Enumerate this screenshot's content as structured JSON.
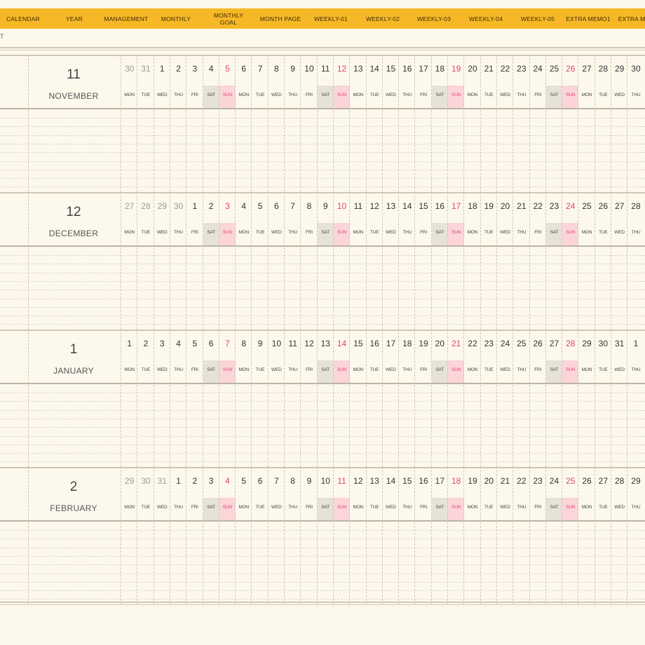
{
  "tabs": [
    {
      "label": "CALENDAR"
    },
    {
      "label": "YEAR"
    },
    {
      "label": "MANAGEMENT"
    },
    {
      "label": "MONTHLY"
    },
    {
      "label": "MONTHLY\nGOAL"
    },
    {
      "label": "MONTH PAGE"
    },
    {
      "label": "WEEKLY-01"
    },
    {
      "label": "WEEKLY-02"
    },
    {
      "label": "WEEKLY-03"
    },
    {
      "label": "WEEKLY-04"
    },
    {
      "label": "WEEKLY-05"
    },
    {
      "label": "EXTRA MEMO1"
    },
    {
      "label": "EXTRA ME"
    }
  ],
  "top_text": "T",
  "weekday_labels": [
    "MON",
    "TUE",
    "WED",
    "THU",
    "FRI",
    "SAT",
    "SUN"
  ],
  "months": [
    {
      "number": "11",
      "name": "NOVEMBER",
      "days": [
        "30",
        "31",
        "1",
        "2",
        "3",
        "4",
        "5",
        "6",
        "7",
        "8",
        "9",
        "10",
        "11",
        "12",
        "13",
        "14",
        "15",
        "16",
        "17",
        "18",
        "19",
        "20",
        "21",
        "22",
        "23",
        "24",
        "25",
        "26",
        "27",
        "28",
        "29",
        "30"
      ],
      "other_month_count": 2
    },
    {
      "number": "12",
      "name": "DECEMBER",
      "days": [
        "27",
        "28",
        "29",
        "30",
        "1",
        "2",
        "3",
        "4",
        "5",
        "6",
        "7",
        "8",
        "9",
        "10",
        "11",
        "12",
        "13",
        "14",
        "15",
        "16",
        "17",
        "18",
        "19",
        "20",
        "21",
        "22",
        "23",
        "24",
        "25",
        "26",
        "27",
        "28"
      ],
      "other_month_count": 4
    },
    {
      "number": "1",
      "name": "JANUARY",
      "days": [
        "1",
        "2",
        "3",
        "4",
        "5",
        "6",
        "7",
        "8",
        "9",
        "10",
        "11",
        "12",
        "13",
        "14",
        "15",
        "16",
        "17",
        "18",
        "19",
        "20",
        "21",
        "22",
        "23",
        "24",
        "25",
        "26",
        "27",
        "28",
        "29",
        "30",
        "31",
        "1"
      ],
      "other_month_count": 0
    },
    {
      "number": "2",
      "name": "FEBRUARY",
      "days": [
        "29",
        "30",
        "31",
        "1",
        "2",
        "3",
        "4",
        "5",
        "6",
        "7",
        "8",
        "9",
        "10",
        "11",
        "12",
        "13",
        "14",
        "15",
        "16",
        "17",
        "18",
        "19",
        "20",
        "21",
        "22",
        "23",
        "24",
        "25",
        "26",
        "27",
        "28",
        "29"
      ],
      "other_month_count": 3
    }
  ],
  "colors": {
    "tab_bar": "#f7b827",
    "background": "#fdf8ec",
    "saturday_fill": "#e7e2d7",
    "sunday_fill": "#fbd5d8",
    "sunday_text": "#e0447a"
  }
}
